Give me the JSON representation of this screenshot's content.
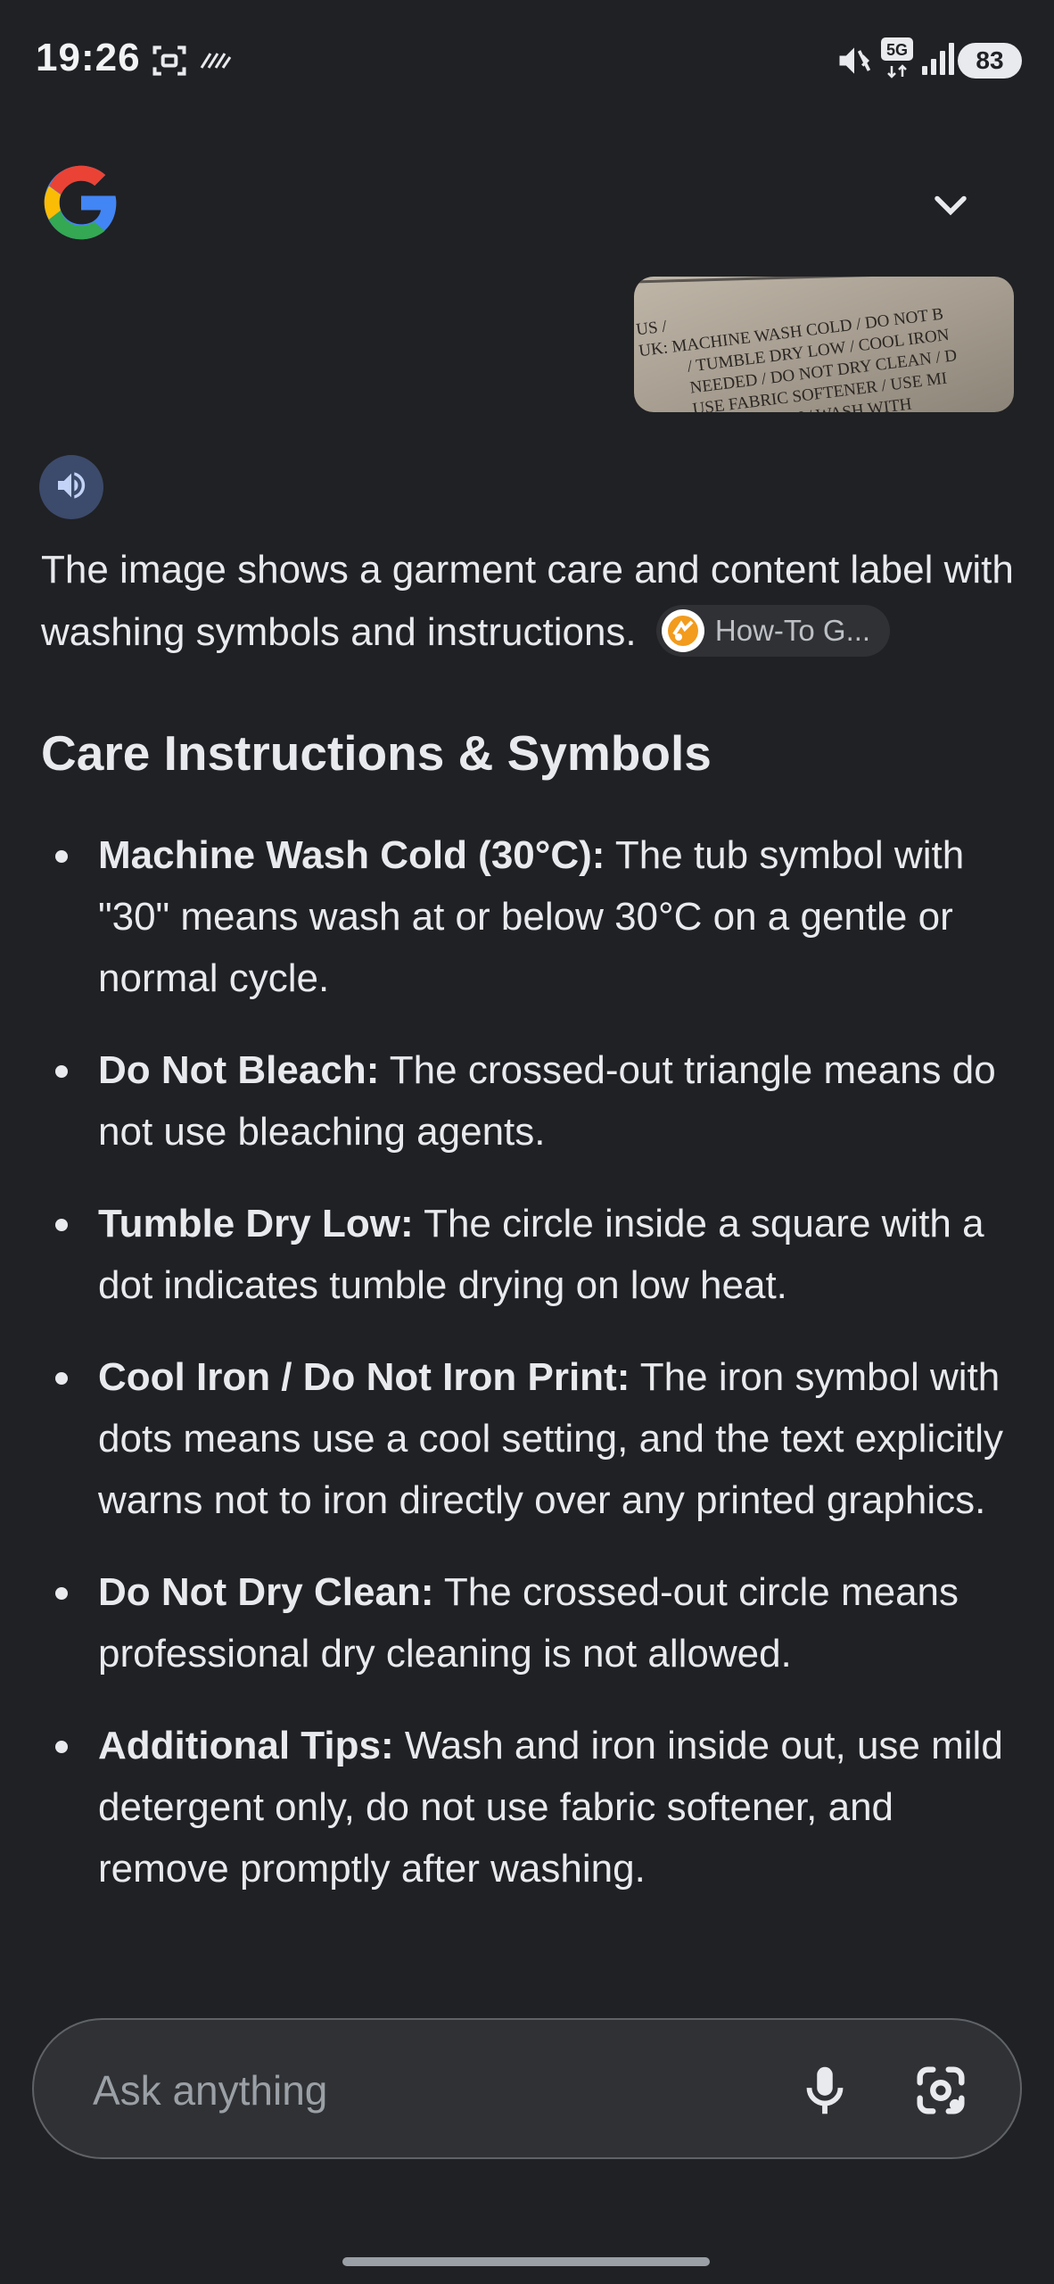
{
  "status_bar": {
    "time": "19:26",
    "battery": "83",
    "network": "5G",
    "icons": [
      "screenshot-icon",
      "nfc-icon",
      "mute-icon",
      "5g-icon",
      "signal-icon",
      "battery-icon"
    ]
  },
  "header": {
    "logo": "google-g-logo",
    "collapse_icon": "chevron-down-icon"
  },
  "image_thumbnail": {
    "lines": [
      "US /",
      "UK: MACHINE WASH COLD / DO NOT B",
      "/ TUMBLE DRY LOW / COOL IRON",
      "NEEDED / DO NOT DRY CLEAN / D",
      "USE FABRIC SOFTENER / USE MI",
      "ONLY / WASH WITH"
    ]
  },
  "answer": {
    "speaker_icon": "speaker-icon",
    "intro": "The image shows a garment care and content label with washing symbols and instructions.",
    "source_chip": "How-To G...",
    "heading": "Care Instructions & Symbols",
    "items": [
      {
        "title": "Machine Wash Cold (30°C):",
        "text": " The tub symbol with \"30\" means wash at or below 30°C on a gentle or normal cycle."
      },
      {
        "title": "Do Not Bleach:",
        "text": " The crossed-out triangle means do not use bleaching agents."
      },
      {
        "title": "Tumble Dry Low:",
        "text": " The circle inside a square with a dot indicates tumble drying on low heat."
      },
      {
        "title": "Cool Iron / Do Not Iron Print:",
        "text": " The iron symbol with dots means use a cool setting, and the text explicitly warns not to iron directly over any printed graphics."
      },
      {
        "title": "Do Not Dry Clean:",
        "text": " The crossed-out circle means professional dry cleaning is not allowed."
      },
      {
        "title": "Additional Tips:",
        "text": " Wash and iron inside out, use mild detergent only, do not use fabric softener, and remove promptly after washing."
      }
    ]
  },
  "input_bar": {
    "placeholder": "Ask anything",
    "mic_icon": "microphone-icon",
    "lens_icon": "camera-search-icon"
  },
  "colors": {
    "background": "#202124",
    "text": "#e8eaed",
    "chip_bg": "#303134",
    "speaker_bg": "#3c4a6b"
  }
}
